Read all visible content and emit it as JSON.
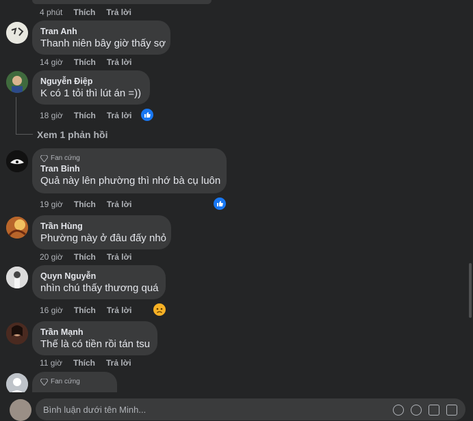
{
  "comments": [
    {
      "author": "",
      "text": "",
      "time": "4 phút",
      "like": "Thích",
      "reply": "Trả lời"
    },
    {
      "author": "Tran Anh",
      "text": "Thanh niên bây giờ thấy sợ",
      "time": "14 giờ",
      "like": "Thích",
      "reply": "Trả lời"
    },
    {
      "author": "Nguyễn Điệp",
      "text": "K có 1 tỏi thì lút án =))",
      "time": "18 giờ",
      "like": "Thích",
      "reply": "Trả lời"
    },
    {
      "author": "Tran Binh",
      "badge": "Fan cứng",
      "text": "Quả này lên phường thì nhớ bà cụ luôn",
      "time": "19 giờ",
      "like": "Thích",
      "reply": "Trả lời"
    },
    {
      "author": "Trần Hùng",
      "text": "Phường này ở đâu đấy nhỏ",
      "time": "20 giờ",
      "like": "Thích",
      "reply": "Trả lời"
    },
    {
      "author": "Quyn Nguyễn",
      "text": "nhìn chú thấy thương quá",
      "time": "16 giờ",
      "like": "Thích",
      "reply": "Trả lời"
    },
    {
      "author": "Trần Mạnh",
      "text": "Thế là có tiền rồi tán tsu",
      "time": "11 giờ",
      "like": "Thích",
      "reply": "Trả lời"
    },
    {
      "badge": "Fan cứng"
    }
  ],
  "replies_link": "Xem 1 phản hồi",
  "composer_placeholder": "Bình luận dưới tên Minh..."
}
